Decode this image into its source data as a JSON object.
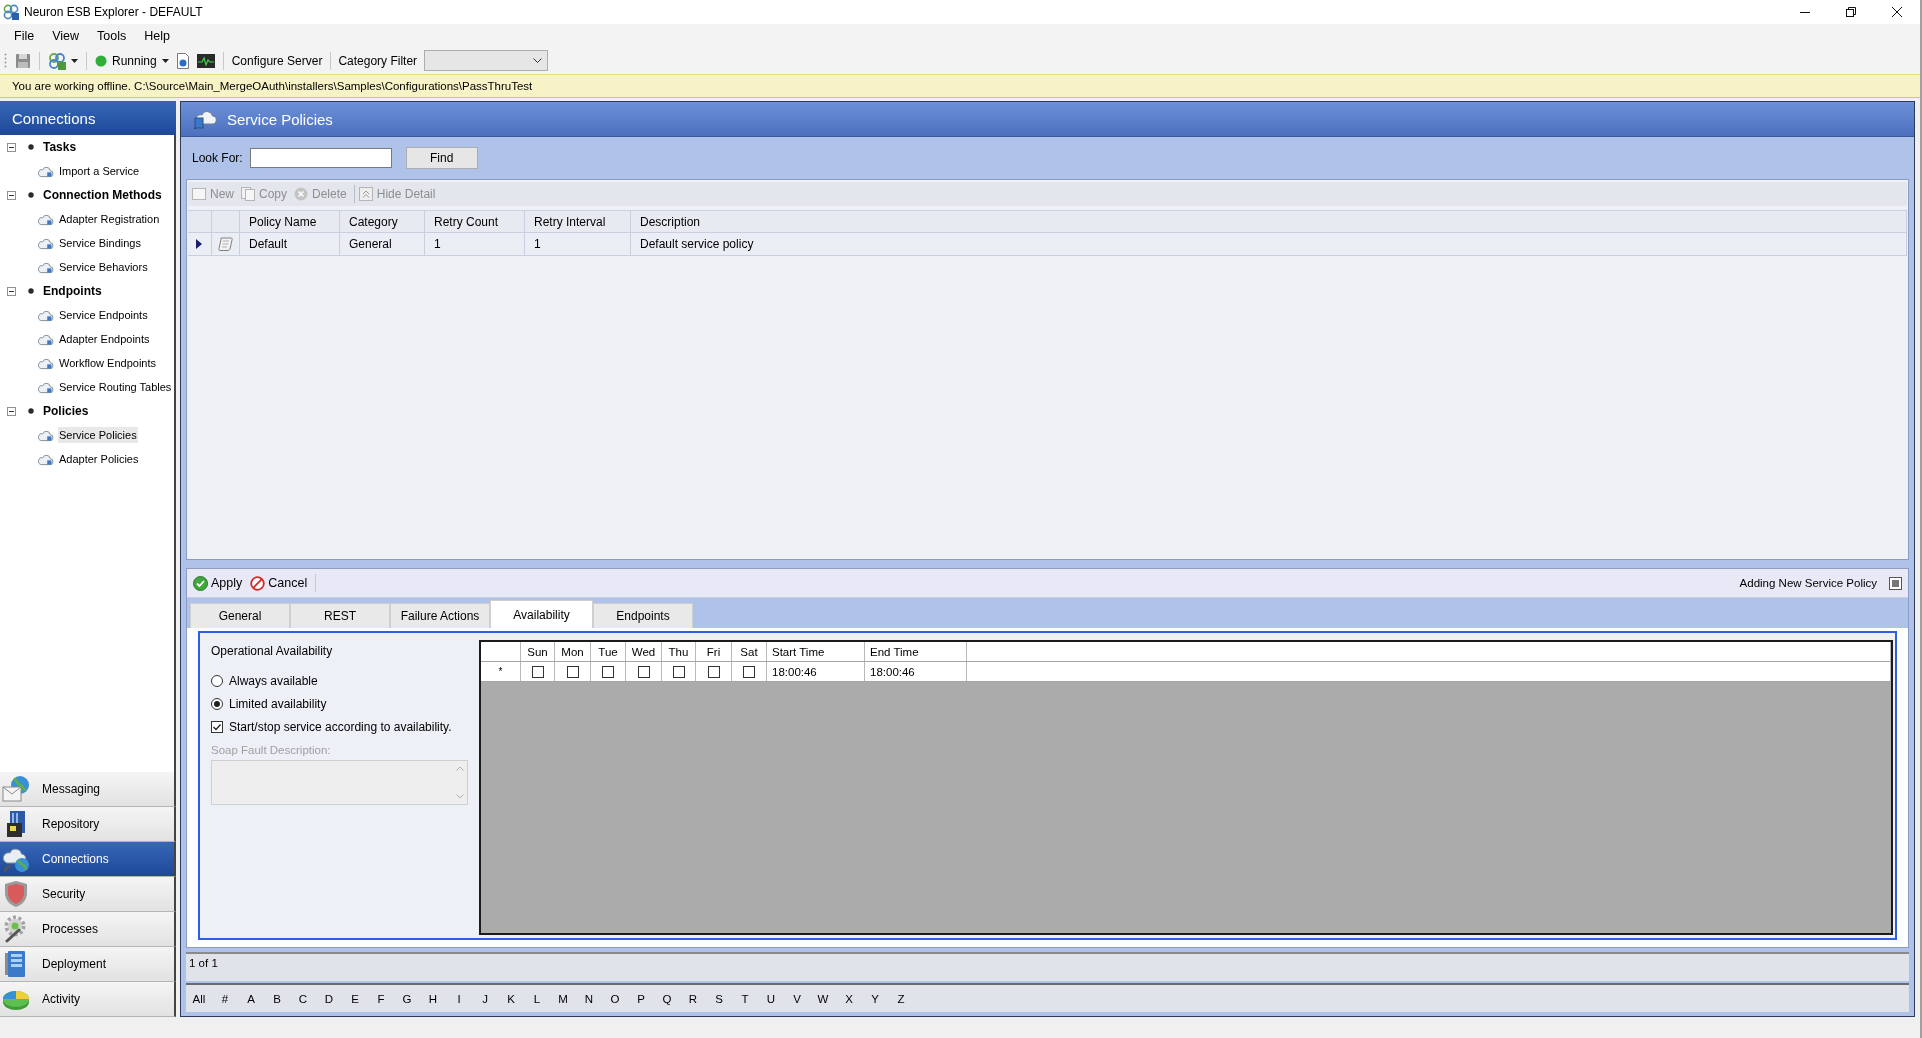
{
  "window": {
    "title": "Neuron ESB Explorer - DEFAULT"
  },
  "menu": [
    "File",
    "View",
    "Tools",
    "Help"
  ],
  "toolbar": {
    "status": "Running",
    "configure": "Configure Server",
    "category_filter": {
      "label": "Category Filter"
    }
  },
  "offline_notice": "You are working offline. C:\\Source\\Main_MergeOAuth\\installers\\Samples\\Configurations\\PassThruTest",
  "sidebar": {
    "title": "Connections",
    "groups": [
      {
        "label": "Tasks",
        "expanded": true,
        "children": [
          {
            "label": "Import a Service",
            "selected": false
          }
        ]
      },
      {
        "label": "Connection Methods",
        "expanded": true,
        "children": [
          {
            "label": "Adapter Registration",
            "selected": false
          },
          {
            "label": "Service Bindings",
            "selected": false
          },
          {
            "label": "Service Behaviors",
            "selected": false
          }
        ]
      },
      {
        "label": "Endpoints",
        "expanded": true,
        "children": [
          {
            "label": "Service Endpoints",
            "selected": false
          },
          {
            "label": "Adapter Endpoints",
            "selected": false
          },
          {
            "label": "Workflow Endpoints",
            "selected": false
          },
          {
            "label": "Service Routing Tables",
            "selected": false
          }
        ]
      },
      {
        "label": "Policies",
        "expanded": true,
        "children": [
          {
            "label": "Service Policies",
            "selected": true
          },
          {
            "label": "Adapter Policies",
            "selected": false
          }
        ]
      }
    ]
  },
  "nav": [
    {
      "label": "Messaging",
      "selected": false
    },
    {
      "label": "Repository",
      "selected": false
    },
    {
      "label": "Connections",
      "selected": true
    },
    {
      "label": "Security",
      "selected": false
    },
    {
      "label": "Processes",
      "selected": false
    },
    {
      "label": "Deployment",
      "selected": false
    },
    {
      "label": "Activity",
      "selected": false
    }
  ],
  "page": {
    "title": "Service Policies",
    "search": {
      "label": "Look For:",
      "button": "Find"
    },
    "grid_toolbar": [
      {
        "label": "New",
        "disabled": true
      },
      {
        "label": "Copy",
        "disabled": true
      },
      {
        "label": "Delete",
        "disabled": true
      },
      {
        "label": "Hide Detail",
        "disabled": true
      }
    ],
    "table": {
      "columns": [
        "Policy Name",
        "Category",
        "Retry Count",
        "Retry Interval",
        "Description"
      ],
      "rows": [
        {
          "current": true,
          "cells": [
            "Default",
            "General",
            "1",
            "1",
            "Default service policy"
          ]
        }
      ]
    }
  },
  "editor": {
    "actions": [
      {
        "kind": "apply",
        "label": "Apply"
      },
      {
        "kind": "cancel",
        "label": "Cancel"
      }
    ],
    "status": "Adding New Service Policy",
    "tabs": [
      {
        "label": "General",
        "selected": false
      },
      {
        "label": "REST",
        "selected": false
      },
      {
        "label": "Failure Actions",
        "selected": false
      },
      {
        "label": "Availability",
        "selected": true
      },
      {
        "label": "Endpoints",
        "selected": false
      }
    ],
    "availability": {
      "title": "Operational Availability",
      "options": [
        {
          "label": "Always available",
          "selected": false
        },
        {
          "label": "Limited availability",
          "selected": true
        }
      ],
      "start_stop": {
        "label": "Start/stop service according to availability.",
        "checked": true
      },
      "soap_fault": {
        "label": "Soap Fault Description:",
        "disabled": true
      },
      "schedule": {
        "columns": [
          "Sun",
          "Mon",
          "Tue",
          "Wed",
          "Thu",
          "Fri",
          "Sat",
          "Start Time",
          "End Time"
        ],
        "rows": [
          {
            "marker": "*",
            "days": [
              {
                "checked": false
              },
              {
                "checked": false
              },
              {
                "checked": false
              },
              {
                "checked": false
              },
              {
                "checked": false
              },
              {
                "checked": false
              },
              {
                "checked": false
              }
            ],
            "start": "18:00:46",
            "end": "18:00:46"
          }
        ]
      }
    }
  },
  "pager": "1 of 1",
  "alphabet": [
    "All",
    "#",
    "A",
    "B",
    "C",
    "D",
    "E",
    "F",
    "G",
    "H",
    "I",
    "J",
    "K",
    "L",
    "M",
    "N",
    "O",
    "P",
    "Q",
    "R",
    "S",
    "T",
    "U",
    "V",
    "W",
    "X",
    "Y",
    "Z"
  ]
}
